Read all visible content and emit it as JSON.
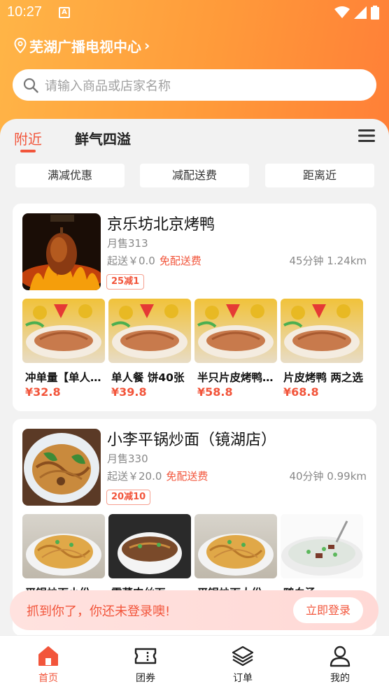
{
  "status_bar": {
    "time": "10:27",
    "app_icon": "A"
  },
  "location": {
    "name": "芜湖广播电视中心",
    "chevron": "›"
  },
  "search": {
    "placeholder": "请输入商品或店家名称"
  },
  "tabs": [
    {
      "label": "附近",
      "active": true
    },
    {
      "label": "鲜气四溢",
      "active": false
    }
  ],
  "filters": [
    "满减优惠",
    "减配送费",
    "距离近"
  ],
  "shops": [
    {
      "name": "京乐坊北京烤鸭",
      "sales": "月售313",
      "min_order": "起送￥0.0",
      "delivery": "免配送费",
      "eta_distance": "45分钟 1.24km",
      "badge": "25减1",
      "dishes": [
        {
          "name": "冲单量【单人餐】",
          "price": "¥32.8"
        },
        {
          "name": "单人餐 饼40张",
          "price": "¥39.8"
        },
        {
          "name": "半只片皮烤鸭套餐",
          "price": "¥58.8"
        },
        {
          "name": "片皮烤鸭 两之选",
          "price": "¥68.8"
        }
      ]
    },
    {
      "name": "小李平锅炒面（镜湖店）",
      "sales": "月售330",
      "min_order": "起送￥20.0",
      "delivery": "免配送费",
      "eta_distance": "40分钟 0.99km",
      "badge": "20减10",
      "dishes": [
        {
          "name": "平锅炒面小份",
          "price": ""
        },
        {
          "name": "雪菜肉丝面",
          "price": ""
        },
        {
          "name": "平锅炒面大份",
          "price": ""
        },
        {
          "name": "鸭血汤",
          "price": ""
        }
      ]
    }
  ],
  "login_prompt": {
    "text": "抓到你了，你还未登录噢!",
    "button": "立即登录"
  },
  "bottom_nav": [
    {
      "label": "首页",
      "icon": "home-icon",
      "active": true
    },
    {
      "label": "团券",
      "icon": "ticket-icon",
      "active": false
    },
    {
      "label": "订单",
      "icon": "layers-icon",
      "active": false
    },
    {
      "label": "我的",
      "icon": "user-icon",
      "active": false
    }
  ],
  "colors": {
    "accent": "#f2553b",
    "header_start": "#ffb547",
    "header_end": "#ff7f37"
  }
}
